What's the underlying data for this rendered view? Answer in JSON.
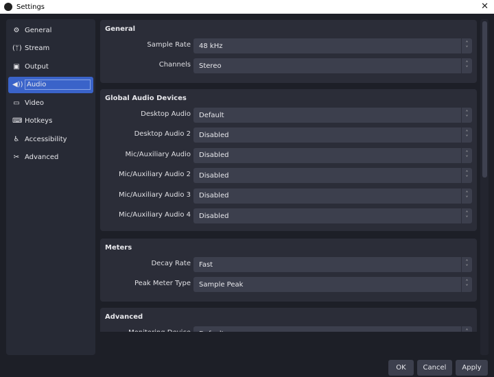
{
  "window": {
    "title": "Settings",
    "close": "✕"
  },
  "sidebar": {
    "items": [
      {
        "label": "General",
        "icon": "⚙"
      },
      {
        "label": "Stream",
        "icon": "(ᛘ)"
      },
      {
        "label": "Output",
        "icon": "▣"
      },
      {
        "label": "Audio",
        "icon": "◀))"
      },
      {
        "label": "Video",
        "icon": "▭"
      },
      {
        "label": "Hotkeys",
        "icon": "⌨"
      },
      {
        "label": "Accessibility",
        "icon": "♿"
      },
      {
        "label": "Advanced",
        "icon": "✂"
      }
    ],
    "active": "Audio"
  },
  "groups": {
    "general": {
      "title": "General",
      "rows": [
        {
          "label": "Sample Rate",
          "value": "48 kHz"
        },
        {
          "label": "Channels",
          "value": "Stereo"
        }
      ]
    },
    "devices": {
      "title": "Global Audio Devices",
      "rows": [
        {
          "label": "Desktop Audio",
          "value": "Default"
        },
        {
          "label": "Desktop Audio 2",
          "value": "Disabled"
        },
        {
          "label": "Mic/Auxiliary Audio",
          "value": "Disabled"
        },
        {
          "label": "Mic/Auxiliary Audio 2",
          "value": "Disabled"
        },
        {
          "label": "Mic/Auxiliary Audio 3",
          "value": "Disabled"
        },
        {
          "label": "Mic/Auxiliary Audio 4",
          "value": "Disabled"
        }
      ]
    },
    "meters": {
      "title": "Meters",
      "rows": [
        {
          "label": "Decay Rate",
          "value": "Fast"
        },
        {
          "label": "Peak Meter Type",
          "value": "Sample Peak"
        }
      ]
    },
    "advanced": {
      "title": "Advanced",
      "rows": [
        {
          "label": "Monitoring Device",
          "value": "Default"
        }
      ]
    }
  },
  "buttons": {
    "ok": "OK",
    "cancel": "Cancel",
    "apply": "Apply"
  }
}
